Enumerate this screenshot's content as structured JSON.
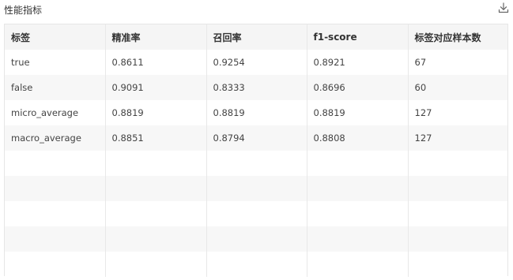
{
  "panel": {
    "title": "性能指标",
    "download_icon": "download-icon"
  },
  "table": {
    "headers": [
      "标签",
      "精准率",
      "召回率",
      "f1-score",
      "标签对应样本数"
    ],
    "rows": [
      [
        "true",
        "0.8611",
        "0.9254",
        "0.8921",
        "67"
      ],
      [
        "false",
        "0.9091",
        "0.8333",
        "0.8696",
        "60"
      ],
      [
        "micro_average",
        "0.8819",
        "0.8819",
        "0.8819",
        "127"
      ],
      [
        "macro_average",
        "0.8851",
        "0.8794",
        "0.8808",
        "127"
      ]
    ],
    "empty_rows": 5
  },
  "colors": {
    "header_bg": "#f5f5f5",
    "stripe_bg": "#f7f7f7",
    "border": "#e8e8e8"
  }
}
